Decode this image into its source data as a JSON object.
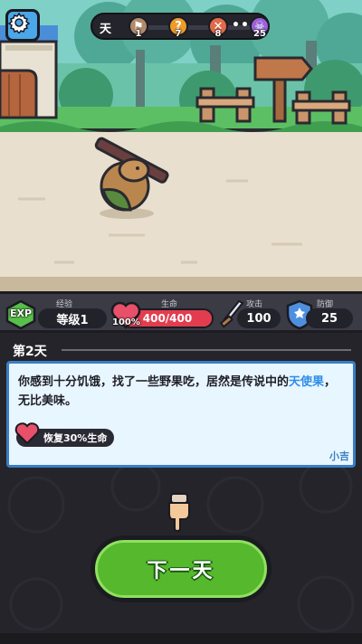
{
  "top": {
    "day_label": "天",
    "stages": [
      {
        "icon": "flag-icon",
        "color": "#b08a6a",
        "num": "1"
      },
      {
        "icon": "question-icon",
        "color": "#ee9b2a",
        "num": "7"
      },
      {
        "icon": "crossed-swords-icon",
        "color": "#e26a4a",
        "num": "8"
      },
      {
        "icon": "skull-boss-icon",
        "color": "#9a63d9",
        "num": "25"
      }
    ],
    "dots": "•••"
  },
  "stats": {
    "level": {
      "caption": "经验",
      "badge": "EXP",
      "value": "等级1"
    },
    "hp": {
      "caption": "生命",
      "value": "400/400",
      "percent_label": "100%",
      "fill_fraction": 1.0
    },
    "attack": {
      "caption": "攻击",
      "value": "100"
    },
    "defense": {
      "caption": "防御",
      "value": "25"
    }
  },
  "event": {
    "day_title": "第2天",
    "text_before": "你感到十分饥饿，找了一些野果吃，居然是传说中的",
    "text_highlight": "天使果",
    "text_after": "，无比美味。",
    "effect": "恢复30%生命",
    "tip": "小吉"
  },
  "action": {
    "next_label": "下一天"
  },
  "colors": {
    "accent_green": "#56b82c",
    "hp_red": "#e23d4f",
    "highlight_blue": "#2f8ee8"
  }
}
